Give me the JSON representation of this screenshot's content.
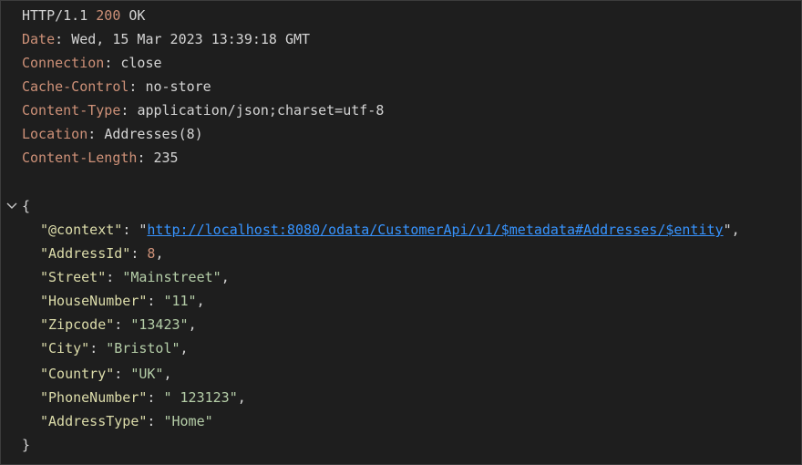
{
  "status_line": {
    "protocol": "HTTP/1.1",
    "code": "200",
    "text": "OK"
  },
  "headers": [
    {
      "name": "Date",
      "value": "Wed, 15 Mar 2023 13:39:18 GMT"
    },
    {
      "name": "Connection",
      "value": "close"
    },
    {
      "name": "Cache-Control",
      "value": "no-store"
    },
    {
      "name": "Content-Type",
      "value": "application/json;charset=utf-8"
    },
    {
      "name": "Location",
      "value": "Addresses(8)"
    },
    {
      "name": "Content-Length",
      "value": "235"
    }
  ],
  "body": {
    "open_brace": "{",
    "close_brace": "}",
    "fold_icon": "chevron-down-icon",
    "fields": [
      {
        "key": "\"@context\"",
        "value": "http://localhost:8080/odata/CustomerApi/v1/$metadata#Addresses/$entity",
        "type": "link"
      },
      {
        "key": "\"AddressId\"",
        "value": "8",
        "type": "number"
      },
      {
        "key": "\"Street\"",
        "value": "\"Mainstreet\"",
        "type": "string"
      },
      {
        "key": "\"HouseNumber\"",
        "value": "\"11\"",
        "type": "string"
      },
      {
        "key": "\"Zipcode\"",
        "value": "\"13423\"",
        "type": "string"
      },
      {
        "key": "\"City\"",
        "value": "\"Bristol\"",
        "type": "string"
      },
      {
        "key": "\"Country\"",
        "value": "\"UK\"",
        "type": "string"
      },
      {
        "key": "\"PhoneNumber\"",
        "value": "\" 123123\"",
        "type": "string"
      },
      {
        "key": "\"AddressType\"",
        "value": "\"Home\"",
        "type": "string"
      }
    ]
  },
  "colors": {
    "background": "#1e1e1e",
    "header_name": "#ce9178",
    "status_code": "#ce9178",
    "json_key": "#dcdcaa",
    "json_string": "#ce9178",
    "json_number": "#b5cea8",
    "link": "#3794ff",
    "text": "#d4d4d4"
  }
}
